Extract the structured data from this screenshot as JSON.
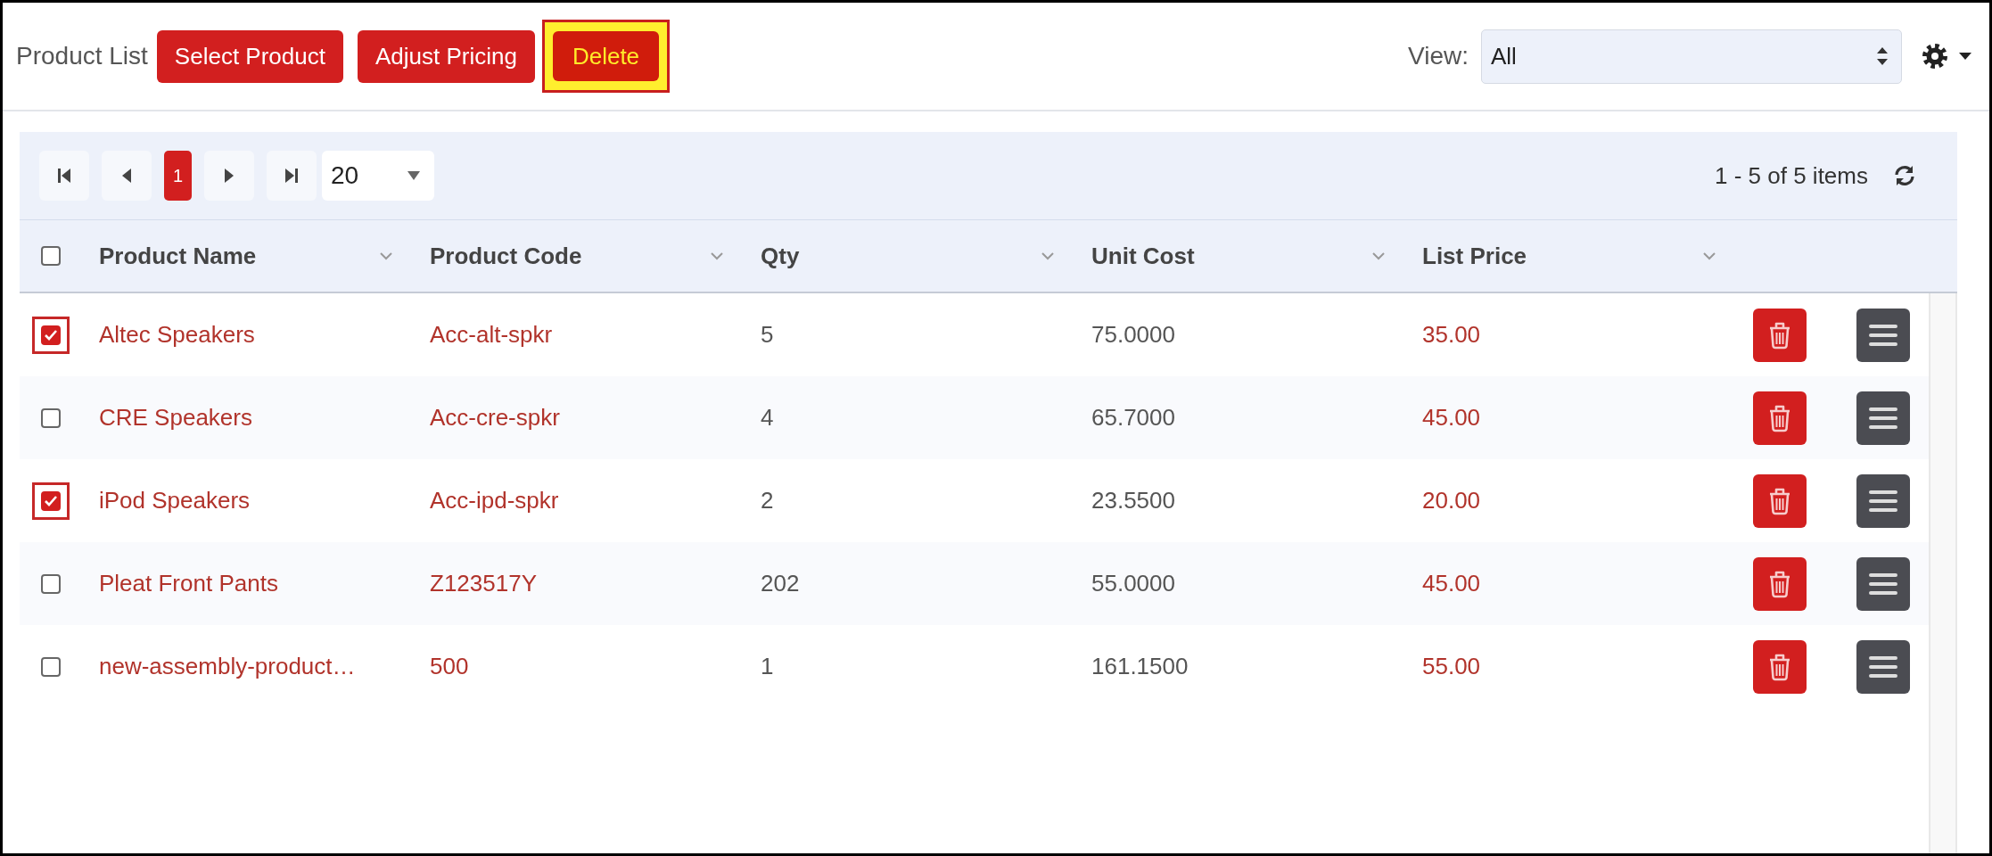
{
  "toolbar": {
    "title": "Product List",
    "buttons": [
      {
        "label": "Select Product",
        "highlighted": false
      },
      {
        "label": "Adjust Pricing",
        "highlighted": false
      },
      {
        "label": "Delete",
        "highlighted": true
      }
    ],
    "view": {
      "label": "View:",
      "value": "All"
    }
  },
  "pager": {
    "pages": [
      {
        "label": "1",
        "selected": true
      }
    ],
    "page_size": "20",
    "summary": "1 - 5 of 5 items"
  },
  "table": {
    "select_all": {
      "checked": false
    },
    "columns": [
      "Product Name",
      "Product Code",
      "Qty",
      "Unit Cost",
      "List Price"
    ],
    "rows": [
      {
        "checked": true,
        "highlighted": true,
        "name": "Altec Speakers",
        "code": "Acc-alt-spkr",
        "qty": "5",
        "unit_cost": "75.0000",
        "list_price": "35.00"
      },
      {
        "checked": false,
        "highlighted": false,
        "name": "CRE Speakers",
        "code": "Acc-cre-spkr",
        "qty": "4",
        "unit_cost": "65.7000",
        "list_price": "45.00"
      },
      {
        "checked": true,
        "highlighted": true,
        "name": "iPod Speakers",
        "code": "Acc-ipd-spkr",
        "qty": "2",
        "unit_cost": "23.5500",
        "list_price": "20.00"
      },
      {
        "checked": false,
        "highlighted": false,
        "name": "Pleat Front Pants",
        "code": "Z123517Y",
        "qty": "202",
        "unit_cost": "55.0000",
        "list_price": "45.00"
      },
      {
        "checked": false,
        "highlighted": false,
        "name": "new-assembly-product…",
        "code": "500",
        "qty": "1",
        "unit_cost": "161.1500",
        "list_price": "55.00"
      }
    ]
  }
}
